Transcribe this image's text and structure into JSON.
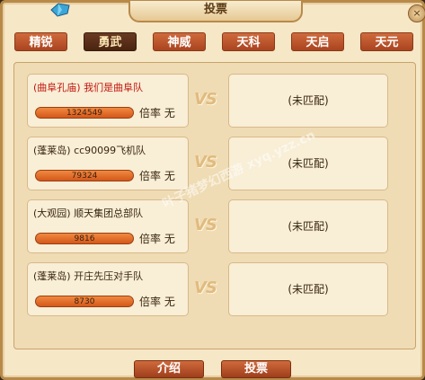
{
  "window": {
    "title": "投票",
    "close_label": "×"
  },
  "tabs": [
    {
      "label": "精锐",
      "active": false
    },
    {
      "label": "勇武",
      "active": true
    },
    {
      "label": "神威",
      "active": false
    },
    {
      "label": "天科",
      "active": false
    },
    {
      "label": "天启",
      "active": false
    },
    {
      "label": "天元",
      "active": false
    }
  ],
  "matches": [
    {
      "team": "(曲阜孔庙) 我们是曲阜队",
      "votes": "1324549",
      "rate_label": "倍率",
      "rate_value": "无",
      "vs": "VS",
      "opponent": "(未匹配)",
      "highlight": true
    },
    {
      "team": "(蓬莱岛) cc90099飞机队",
      "votes": "79324",
      "rate_label": "倍率",
      "rate_value": "无",
      "vs": "VS",
      "opponent": "(未匹配)",
      "highlight": false
    },
    {
      "team": "(大观园) 顺天集团总部队",
      "votes": "9816",
      "rate_label": "倍率",
      "rate_value": "无",
      "vs": "VS",
      "opponent": "(未匹配)",
      "highlight": false
    },
    {
      "team": "(蓬莱岛) 开庄先压对手队",
      "votes": "8730",
      "rate_label": "倍率",
      "rate_value": "无",
      "vs": "VS",
      "opponent": "(未匹配)",
      "highlight": false
    }
  ],
  "buttons": {
    "intro": "介绍",
    "vote": "投票"
  },
  "watermark": "叶子猪梦幻西游 xyq.yzz.cn",
  "colors": {
    "accent": "#c0140c",
    "button": "#b4502a"
  }
}
